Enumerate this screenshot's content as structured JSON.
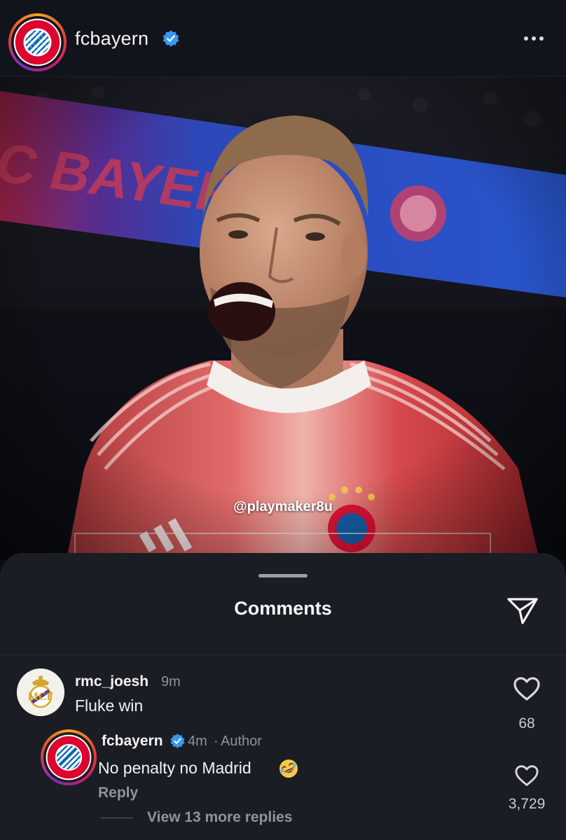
{
  "header": {
    "username": "fcbayern",
    "verified": true,
    "avatar_icon": "fc-bayern-crest-icon",
    "more_icon": "more-horizontal-icon"
  },
  "post": {
    "tag_label": "@playmaker8u"
  },
  "comments_sheet": {
    "title": "Comments",
    "share_icon": "paper-plane-icon",
    "comments": [
      {
        "username": "rmc_joesh",
        "time": "9m",
        "text": "Fluke win",
        "likes": "68",
        "avatar_icon": "real-madrid-crest-icon"
      },
      {
        "username": "fcbayern",
        "verified": true,
        "time": "4m",
        "separator": "·",
        "author_label": "Author",
        "text": "No penalty no Madrid",
        "emoji_icon": "rolling-laughing-emoji-icon",
        "reply_label": "Reply",
        "likes": "3,729",
        "avatar_icon": "fc-bayern-crest-icon"
      }
    ],
    "view_more_replies": "View 13 more replies"
  },
  "colors": {
    "background": "#0b0d12",
    "sheet": "#1a1d23",
    "verified_blue": "#3897f0",
    "bayern_red": "#dc052d",
    "bayern_blue": "#0066b2",
    "muted_text": "#8e939c"
  }
}
